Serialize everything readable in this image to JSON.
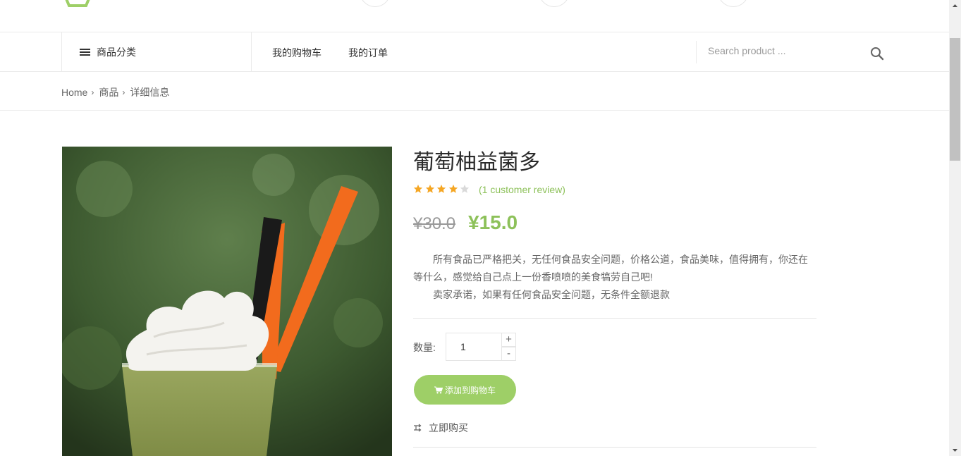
{
  "nav": {
    "category_label": "商品分类",
    "cart_link": "我的购物车",
    "orders_link": "我的订单",
    "search_placeholder": "Search product ..."
  },
  "breadcrumb": {
    "items": [
      "Home",
      "商品",
      "详细信息"
    ]
  },
  "product": {
    "title": "葡萄柚益菌多",
    "rating": 4,
    "rating_max": 5,
    "review_text": "(1 customer review)",
    "old_price": "¥30.0",
    "new_price": "¥15.0",
    "description": [
      "所有食品已严格把关，无任何食品安全问题，价格公道，食品美味，值得拥有，你还在等什么，感觉给自己点上一份香喷喷的美食犒劳自己吧!",
      "卖家承诺，如果有任何食品安全问题，无条件全额退款"
    ],
    "quantity_label": "数量:",
    "quantity_value": "1",
    "qty_plus": "+",
    "qty_minus": "-",
    "add_to_cart": "添加到购物车",
    "buy_now": "立即购买"
  },
  "colors": {
    "accent": "#8dc15a",
    "button": "#9ecf67",
    "star_filled": "#f5a623",
    "star_empty": "#d9d9d9"
  },
  "icons": {
    "menu": "hamburger-icon",
    "search": "search-icon",
    "cart": "cart-icon",
    "buy": "shuffle-icon",
    "separator": "chevron-right-icon"
  }
}
